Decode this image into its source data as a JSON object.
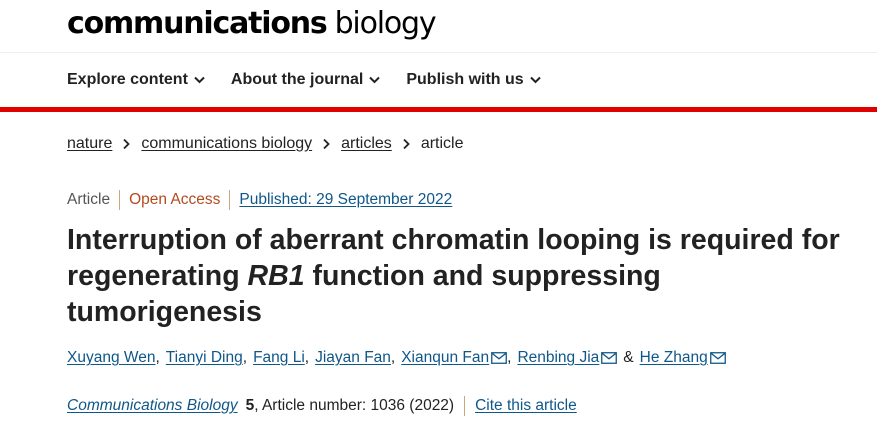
{
  "header": {
    "logo_bold": "communications",
    "logo_light": "biology"
  },
  "nav": {
    "items": [
      {
        "label": "Explore content",
        "icon": "chevron-down-icon"
      },
      {
        "label": "About the journal",
        "icon": "chevron-down-icon"
      },
      {
        "label": "Publish with us",
        "icon": "chevron-down-icon"
      }
    ]
  },
  "breadcrumb": {
    "items": [
      "nature",
      "communications biology",
      "articles"
    ],
    "current": "article"
  },
  "article": {
    "type": "Article",
    "access": "Open Access",
    "published": "Published: 29 September 2022",
    "title_part1": "Interruption of aberrant chromatin looping is required for regenerating ",
    "title_gene": "RB1",
    "title_part2": " function and suppressing tumorigenesis",
    "authors": [
      {
        "name": "Xuyang Wen",
        "email": false
      },
      {
        "name": "Tianyi Ding",
        "email": false
      },
      {
        "name": "Fang Li",
        "email": false
      },
      {
        "name": "Jiayan Fan",
        "email": false
      },
      {
        "name": "Xianqun Fan",
        "email": true
      },
      {
        "name": "Renbing Jia",
        "email": true
      }
    ],
    "author_separator": "&",
    "last_author": {
      "name": "He Zhang",
      "email": true
    },
    "journal": "Communications Biology",
    "volume": "5",
    "article_number": ", Article number: 1036 (2022)",
    "cite_label": "Cite this article"
  },
  "colors": {
    "accent_red": "#e00000",
    "link_blue": "#0f5789",
    "open_access": "#b44a1e",
    "divider_tan": "#c9a779"
  }
}
